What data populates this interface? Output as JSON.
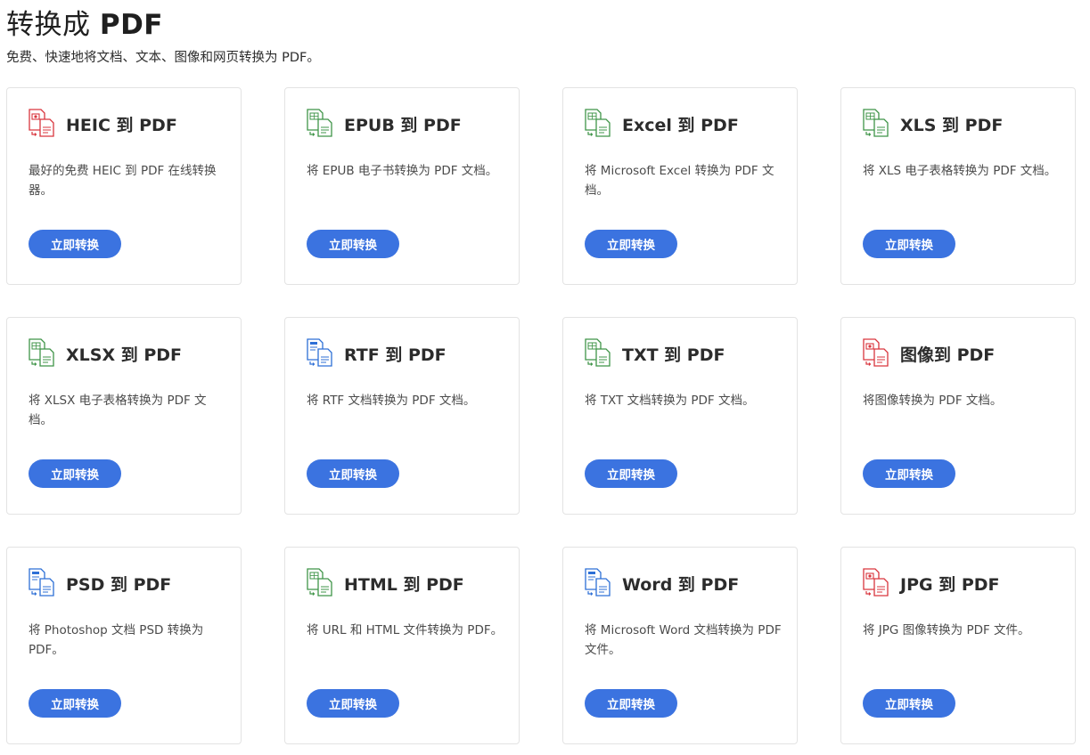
{
  "page": {
    "title": "转换成",
    "title_suffix": "PDF",
    "subtitle": "免费、快速地将文档、文本、图像和网页转换为 PDF。"
  },
  "colors": {
    "accent": "#3b73e0",
    "icon_red": "#d9363e",
    "icon_green": "#3f9448",
    "icon_blue": "#2d6fd6"
  },
  "cards": [
    {
      "title": "HEIC 到 PDF",
      "description": "最好的免费 HEIC 到 PDF 在线转换器。",
      "button_label": "立即转换",
      "icon": "heic-file-icon",
      "icon_color": "red"
    },
    {
      "title": "EPUB 到 PDF",
      "description": "将 EPUB 电子书转换为 PDF 文档。",
      "button_label": "立即转换",
      "icon": "epub-file-icon",
      "icon_color": "green"
    },
    {
      "title": "Excel 到 PDF",
      "description": "将 Microsoft Excel 转换为 PDF 文档。",
      "button_label": "立即转换",
      "icon": "excel-file-icon",
      "icon_color": "green"
    },
    {
      "title": "XLS 到 PDF",
      "description": "将 XLS 电子表格转换为 PDF 文档。",
      "button_label": "立即转换",
      "icon": "xls-file-icon",
      "icon_color": "green"
    },
    {
      "title": "XLSX 到 PDF",
      "description": "将 XLSX 电子表格转换为 PDF 文档。",
      "button_label": "立即转换",
      "icon": "xlsx-file-icon",
      "icon_color": "green"
    },
    {
      "title": "RTF 到 PDF",
      "description": "将 RTF 文档转换为 PDF 文档。",
      "button_label": "立即转换",
      "icon": "rtf-file-icon",
      "icon_color": "blue"
    },
    {
      "title": "TXT 到 PDF",
      "description": "将 TXT 文档转换为 PDF 文档。",
      "button_label": "立即转换",
      "icon": "txt-file-icon",
      "icon_color": "green"
    },
    {
      "title": "图像到 PDF",
      "description": "将图像转换为 PDF 文档。",
      "button_label": "立即转换",
      "icon": "image-file-icon",
      "icon_color": "red"
    },
    {
      "title": "PSD 到 PDF",
      "description": "将 Photoshop 文档 PSD 转换为 PDF。",
      "button_label": "立即转换",
      "icon": "psd-file-icon",
      "icon_color": "blue"
    },
    {
      "title": "HTML 到 PDF",
      "description": "将 URL 和 HTML 文件转换为 PDF。",
      "button_label": "立即转换",
      "icon": "html-file-icon",
      "icon_color": "green"
    },
    {
      "title": "Word 到 PDF",
      "description": "将 Microsoft Word 文档转换为 PDF 文件。",
      "button_label": "立即转换",
      "icon": "word-file-icon",
      "icon_color": "blue"
    },
    {
      "title": "JPG 到 PDF",
      "description": "将 JPG 图像转换为 PDF 文件。",
      "button_label": "立即转换",
      "icon": "jpg-file-icon",
      "icon_color": "red"
    }
  ]
}
